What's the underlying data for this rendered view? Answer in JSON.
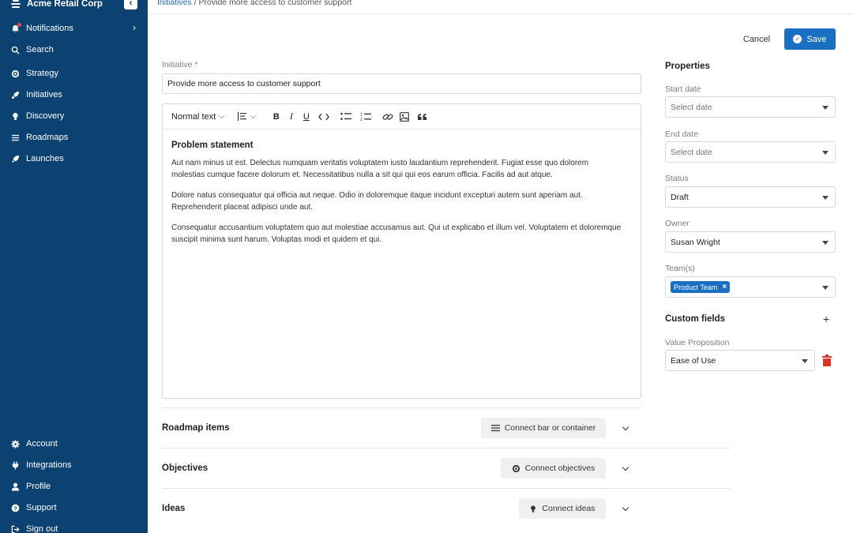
{
  "sidebar": {
    "org_name": "Acme Retail Corp",
    "collapse_icon": "chevron-left-icon",
    "top_items": [
      {
        "label": "Notifications",
        "icon": "bell-icon",
        "has_chevron": true,
        "has_dot": true
      },
      {
        "label": "Search",
        "icon": "search-icon"
      },
      {
        "label": "Strategy",
        "icon": "target-icon"
      },
      {
        "label": "Initiatives",
        "icon": "rocket-icon"
      },
      {
        "label": "Discovery",
        "icon": "lightbulb-icon"
      },
      {
        "label": "Roadmaps",
        "icon": "list-icon"
      },
      {
        "label": "Launches",
        "icon": "rocket-launch-icon"
      }
    ],
    "bottom_items": [
      {
        "label": "Account",
        "icon": "gear-icon"
      },
      {
        "label": "Integrations",
        "icon": "plug-icon"
      },
      {
        "label": "Profile",
        "icon": "user-icon"
      },
      {
        "label": "Support",
        "icon": "help-icon"
      },
      {
        "label": "Sign out",
        "icon": "sign-out-icon"
      }
    ],
    "background_color": "#0c4272"
  },
  "breadcrumb": {
    "parent": "Initiatives",
    "separator": "/",
    "current": "Provide more access to customer support"
  },
  "actions": {
    "cancel_label": "Cancel",
    "save_label": "Save",
    "accent_color": "#1a6fc2"
  },
  "initiative": {
    "label": "Initiative *",
    "value": "Provide more access to customer support"
  },
  "editor": {
    "text_style": "Normal text",
    "heading": "Problem statement",
    "paragraphs": [
      "Aut nam minus ut est. Delectus numquam veritatis voluptatem iusto laudantium reprehenderit. Fugiat esse quo dolorem molestias cumque facere dolorum et. Necessitatibus nulla a sit qui qui eos earum officia. Facilis ad aut atque.",
      "Dolore natus consequatur qui officia aut neque. Odio in doloremque itaque incidunt excepturi autem sunt aperiam aut. Reprehenderit placeat adipisci unde aut.",
      "Consequatur accusantium voluptatem quo aut molestiae accusamus aut. Qui ut explicabo et illum vel. Voluptatem et doloremque suscipit minima sunt harum. Voluptas modi et quidem et qui."
    ]
  },
  "properties": {
    "title": "Properties",
    "start_date": {
      "label": "Start date",
      "placeholder": "Select date"
    },
    "end_date": {
      "label": "End date",
      "placeholder": "Select date"
    },
    "status": {
      "label": "Status",
      "value": "Draft"
    },
    "owner": {
      "label": "Owner",
      "value": "Susan Wright"
    },
    "teams": {
      "label": "Team(s)",
      "chips": [
        "Product Team"
      ],
      "chip_remove": "×"
    }
  },
  "custom_fields": {
    "title": "Custom fields",
    "add_label": "+",
    "value_proposition": {
      "label": "Value Proposition",
      "value": "Ease of Use"
    },
    "delete_color": "#d9342b"
  },
  "sections": [
    {
      "title": "Roadmap items",
      "button_label": "Connect bar or container",
      "button_icon": "list-icon"
    },
    {
      "title": "Objectives",
      "button_label": "Connect objectives",
      "button_icon": "target-icon"
    },
    {
      "title": "Ideas",
      "button_label": "Connect ideas",
      "button_icon": "lightbulb-icon"
    }
  ]
}
